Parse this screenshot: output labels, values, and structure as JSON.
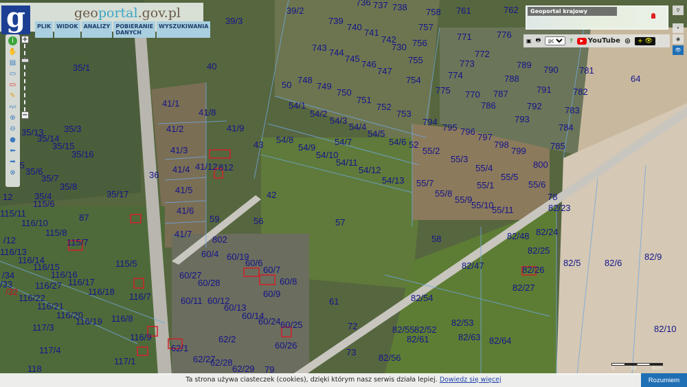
{
  "header": {
    "logo_letter": "g",
    "site_title_a": "geo",
    "site_title_b": "portal",
    ".": "",
    "site_title_c": ".gov.pl",
    "menu": [
      "PLIK",
      "WIDOK",
      "ANALIZY",
      "POBIERANIE DANYCH",
      "WYSZUKIWANIA"
    ]
  },
  "toolbar": {
    "icons": [
      "info-icon",
      "hand-pan-icon",
      "legend-icon",
      "select-rect-icon",
      "select-red-icon",
      "pencil-icon",
      "measure-icon",
      "zoom-in-icon",
      "zoom-out-icon",
      "globe-icon",
      "arrow-back-icon",
      "arrow-forward-icon",
      "full-extent-icon"
    ],
    "glyphs": [
      "i",
      "✋",
      "▤",
      "▭",
      "▭",
      "✎",
      "xyz",
      "⊕",
      "⊖",
      "●",
      "⬅",
      "➡",
      "⊗"
    ]
  },
  "zoom": {
    "plus": "+",
    "minus": "−",
    "level_fraction": 0.3
  },
  "minimap": {
    "title": "Geoportal krajowy"
  },
  "right_toolbar": {
    "language": "pol",
    "youtube": "YouTube",
    "contrast": "+ 👁"
  },
  "scale": {
    "labels": [
      "0",
      "30",
      "60m"
    ]
  },
  "cookie": {
    "text": "Ta strona używa ciasteczek (cookies), dzięki którym nasz serwis działa lepiej.",
    "link": "Dowiedz się więcej",
    "button": "Rozumiem"
  },
  "colors": {
    "accent": "#1f6fb5",
    "label": "#14148a",
    "building": "#d0202a"
  },
  "map": {
    "parcels": [
      "39/3",
      "39/2",
      "739",
      "736",
      "737",
      "738",
      "758",
      "761",
      "762",
      "740",
      "741",
      "757",
      "771",
      "776",
      "743",
      "744",
      "742",
      "730",
      "756",
      "772",
      "745",
      "746",
      "755",
      "773",
      "789",
      "790",
      "781",
      "35/1",
      "40",
      "747",
      "774",
      "788",
      "748",
      "749",
      "754",
      "64",
      "50",
      "750",
      "775",
      "770",
      "787",
      "791",
      "782",
      "751",
      "752",
      "786",
      "792",
      "783",
      "41/1",
      "54/1",
      "41/8",
      "753",
      "54/2",
      "793",
      "54/3",
      "794",
      "795",
      "796",
      "784",
      "41/2",
      "41/9",
      "54/4",
      "797",
      "35/13",
      "35/3",
      "35/14",
      "54/5",
      "54/8",
      "54/7",
      "54/6",
      "52",
      "798",
      "785",
      "35/15",
      "43",
      "54/9",
      "55/2",
      "799",
      "41/3",
      "54/10",
      "35/16",
      "55/3",
      "54/11",
      "800",
      "/5",
      "41/12",
      "812",
      "54/12",
      "55/4",
      "35/6",
      "41/4",
      "36",
      "35/7",
      "55/5",
      "54/13",
      "35/8",
      "41/5",
      "55/6",
      "55/7",
      "55/1",
      "35/4",
      "35/17",
      "42",
      "55/8",
      "12",
      "115/6",
      "55/9",
      "78",
      "41/6",
      "55/10",
      "82/23",
      "115/11",
      "87",
      "59",
      "56",
      "57",
      "55/11",
      "116/10",
      "115/8",
      "41/7",
      "/12",
      "115/7",
      "802",
      "58",
      "82/48",
      "82/24",
      "116/13",
      "60/4",
      "60/19",
      "82/25",
      "116/14",
      "115/5",
      "60/6",
      "82/47",
      "82/5",
      "82/6",
      "82/9",
      "116/15",
      "60/7",
      "82/26",
      "/34",
      "116/16",
      "60/27",
      "60/8",
      "/33",
      "116/17",
      "60/28",
      "82/27",
      "/32",
      "116/27",
      "116/18",
      "60/9",
      "116/22",
      "116/7",
      "60/11",
      "60/12",
      "61",
      "82/54",
      "116/21",
      "60/13",
      "116/20",
      "60/14",
      "116/8",
      "82/53",
      "116/19",
      "60/24",
      "60/25",
      "72",
      "117/3",
      "82/55",
      "82/52",
      "82/10",
      "116/9",
      "62/2",
      "82/61",
      "82/63",
      "82/64",
      "62/1",
      "60/26",
      "117/4",
      "73",
      "82/56",
      "62/27",
      "62/28",
      "117/1",
      "118",
      "62/29",
      "79"
    ]
  }
}
